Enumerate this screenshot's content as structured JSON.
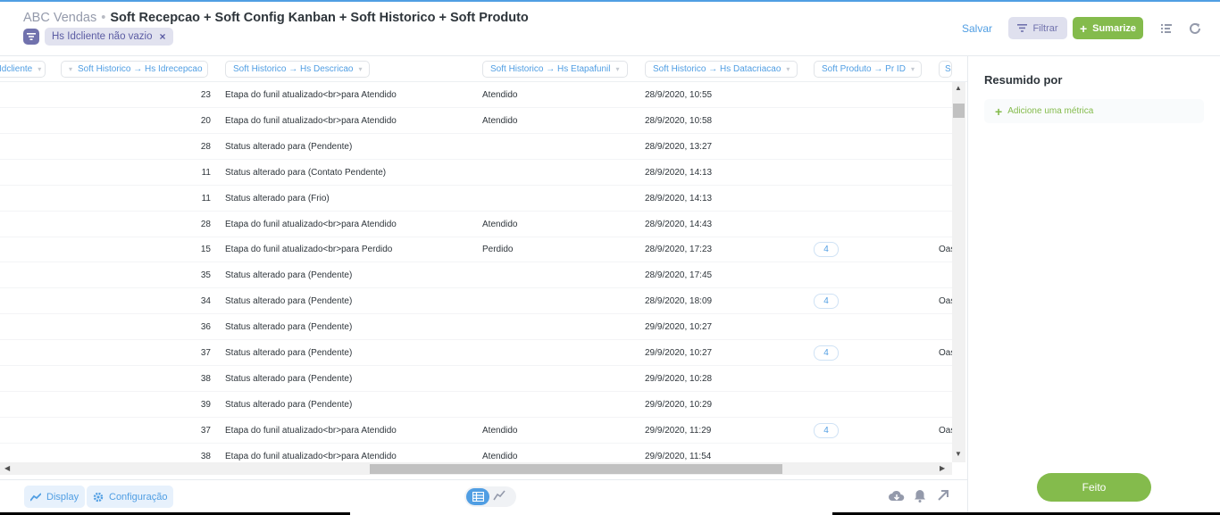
{
  "header": {
    "database": "ABC Vendas",
    "separator": "•",
    "table_title": "Soft Recepcao + Soft Config Kanban + Soft Historico + Soft Produto",
    "filter_pill": "Hs Idcliente não vazio",
    "filter_remove": "×",
    "save_label": "Salvar",
    "filter_label": "Filtrar",
    "summarize_label": "Sumarize"
  },
  "columns": [
    {
      "label": "Idcliente"
    },
    {
      "label": "Soft Historico → Hs Idrecepcao"
    },
    {
      "label": "Soft Historico → Hs Descricao"
    },
    {
      "label": "Soft Historico → Hs Etapafunil"
    },
    {
      "label": "Soft Historico → Hs Datacriacao"
    },
    {
      "label": "Soft Produto → Pr ID"
    },
    {
      "label": "Soft Pr"
    }
  ],
  "rows": [
    {
      "id": "23",
      "desc": "Etapa do funil atualizado<br>para Atendido",
      "etapa": "Atendido",
      "data": "28/9/2020, 10:55",
      "pr": "",
      "last": ""
    },
    {
      "id": "20",
      "desc": "Etapa do funil atualizado<br>para Atendido",
      "etapa": "Atendido",
      "data": "28/9/2020, 10:58",
      "pr": "",
      "last": ""
    },
    {
      "id": "28",
      "desc": "Status alterado para (Pendente)",
      "etapa": "",
      "data": "28/9/2020, 13:27",
      "pr": "",
      "last": ""
    },
    {
      "id": "11",
      "desc": "Status alterado para (Contato Pendente)",
      "etapa": "",
      "data": "28/9/2020, 14:13",
      "pr": "",
      "last": ""
    },
    {
      "id": "11",
      "desc": "Status alterado para (Frio)",
      "etapa": "",
      "data": "28/9/2020, 14:13",
      "pr": "",
      "last": ""
    },
    {
      "id": "28",
      "desc": "Etapa do funil atualizado<br>para Atendido",
      "etapa": "Atendido",
      "data": "28/9/2020, 14:43",
      "pr": "",
      "last": ""
    },
    {
      "id": "15",
      "desc": "Etapa do funil atualizado<br>para Perdido",
      "etapa": "Perdido",
      "data": "28/9/2020, 17:23",
      "pr": "4",
      "last": "Oas"
    },
    {
      "id": "35",
      "desc": "Status alterado para (Pendente)",
      "etapa": "",
      "data": "28/9/2020, 17:45",
      "pr": "",
      "last": ""
    },
    {
      "id": "34",
      "desc": "Status alterado para (Pendente)",
      "etapa": "",
      "data": "28/9/2020, 18:09",
      "pr": "4",
      "last": "Oas"
    },
    {
      "id": "36",
      "desc": "Status alterado para (Pendente)",
      "etapa": "",
      "data": "29/9/2020, 10:27",
      "pr": "",
      "last": ""
    },
    {
      "id": "37",
      "desc": "Status alterado para (Pendente)",
      "etapa": "",
      "data": "29/9/2020, 10:27",
      "pr": "4",
      "last": "Oas"
    },
    {
      "id": "38",
      "desc": "Status alterado para (Pendente)",
      "etapa": "",
      "data": "29/9/2020, 10:28",
      "pr": "",
      "last": ""
    },
    {
      "id": "39",
      "desc": "Status alterado para (Pendente)",
      "etapa": "",
      "data": "29/9/2020, 10:29",
      "pr": "",
      "last": ""
    },
    {
      "id": "37",
      "desc": "Etapa do funil atualizado<br>para Atendido",
      "etapa": "Atendido",
      "data": "29/9/2020, 11:29",
      "pr": "4",
      "last": "Oas"
    },
    {
      "id": "38",
      "desc": "Etapa do funil atualizado<br>para Atendido",
      "etapa": "Atendido",
      "data": "29/9/2020, 11:54",
      "pr": "",
      "last": ""
    }
  ],
  "sidebar": {
    "title": "Resumido por",
    "add_metric": "Adicione uma métrica",
    "done_label": "Feito"
  },
  "footer": {
    "display_label": "Display",
    "settings_label": "Configuração"
  },
  "colors": {
    "accent": "#509ee3",
    "filter": "#7172ad",
    "summarize": "#84bb4c"
  }
}
